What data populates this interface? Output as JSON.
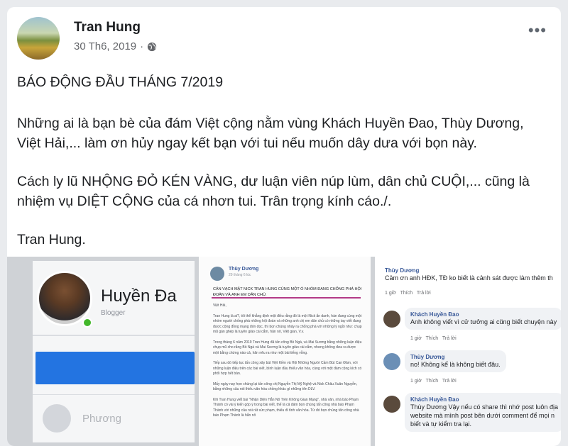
{
  "post": {
    "author": "Tran Hung",
    "date": "30 Th6, 2019",
    "separator": "·",
    "more_label": "•••",
    "title": "BÁO ĐỘNG ĐẦU THÁNG 7/2019",
    "paragraph1": "Những ai là bạn bè của đám Việt cộng nằm vùng Khách Huyền Đao, Thùy Dương, Việt Hải,... làm ơn hủy ngay kết bạn với tui nếu muốn dây dưa với bọn này.",
    "paragraph2": "Cách ly lũ NHỘNG ĐỎ KÉN VÀNG, dư luận viên núp lùm, dân chủ CUỘI,... cũng là nhiệm vụ DIỆT CỘNG của cá nhơn tui. Trân trọng kính cáo./.",
    "signature": "Tran Hung."
  },
  "screenshot_profile": {
    "name": "Huyền Đa",
    "subtitle": "Blogger",
    "partial_label": "Phương"
  },
  "screenshot_post": {
    "author": "Thùy Dương",
    "date": "29 tháng 6 lúc",
    "headline": "CẢN VẠCH MẶT NICK TRAN HUNG CÙNG MỘT Ổ NHÓM ĐANG CHỐNG PHÁ HỘI ĐOÀN VÀ ANH EM DÂN CHỦ.",
    "greeting": "Việt Hải,",
    "paragraphs": [
      "Tran Hung là ai?, tôi thể khẳng định một điều rằng đó là một Nick ẩn danh, hàn đang cùng một nhóm người chống phá những hội đoàn và những anh chị em dân chủ có những tay viết đang được cộng đồng mạng đón đọc, thì bọn chúng nhảy ra chống phá với những lý ngồi như: chụp mũ gán ghép là tuyên giáo cài cắm, hăn nô, Việt gian, V.v.",
      "Trong tháng 6 năm 2019 Tran Hung đã tấn công Bồ Ngà, và Mai Sương bằng những luận điệu chụp mũ cho rằng Bồ Ngà và Mai Sương là tuyên giáo cài cắm, nhưng không đưa ra được một bằng chứng nào cả, hăn nêu ra như một bài tiếng vỗng.",
      "Tiếp sau đó tiếp tục tấn công xây bút Việt Kiền và Hội Những Người Cầm Bút Can Đảm, với những luận điệu trên các bài viết, bình luận đầu thiếu văn hóa, cùng với một đám cộng kích có phối hợp hết bản.",
      "Mấy ngày nay họn chúng lại tấn công chị Nguyễn Thị Mỹ Nghệ và Nick Châu Xuân Nguyễn, bằng những câu nói thiếu văn hóa chồng khác gì những tên DLV.",
      "Khi Tran Hung viết bài \"Nhận Diện Hẳn Nô Trên Không Gian Mạng\", nhà văn, nhà báo Phạm Thành có vài ý kiến góp ý trong bài viết, thế là cả đám bọn chúng tấn công nhà báo Phạm Thành với những câu nói rất sức phạm, thiếu đi tính văn hóa. Từ đó bọn chúng tấn công nhà báo Phạm Thành là hẳn nô"
    ]
  },
  "screenshot_comments": [
    {
      "author": "Thùy Dương",
      "text": "Cảm ơn anh HĐK, TĐ ko biết là cảnh sát được làm thêm th",
      "time": "1 giờ",
      "like": "Thích",
      "reply": "Trả lời"
    },
    {
      "author": "Khách Huyền Đao",
      "text": "Anh không viết vì cử tưởng ai cũng biết chuyện này",
      "time": "1 giờ",
      "like": "Thích",
      "reply": "Trả lời"
    },
    {
      "author": "Thùy Dương",
      "text": "no! Không kể là không biết đâu.",
      "time": "1 giờ",
      "like": "Thích",
      "reply": "Trả lời"
    },
    {
      "author": "Khách Huyền Đao",
      "text": "Thùy Dương Vậy nếu có share thì nhớ post luôn địa",
      "text2": "website mà mình post bên dưới comment để mọi n",
      "text3": "biết và tự kiểm tra lại.",
      "time": "1 giờ",
      "like": "Thích",
      "reply": "Trả lời"
    }
  ],
  "colors": {
    "link": "#385898",
    "secondary_text": "#65676b",
    "blue_bar": "#2374e1",
    "online": "#42b72a",
    "headline_rule": "#b23a87"
  },
  "icons": [
    "globe-icon",
    "more-icon",
    "online-status-icon"
  ]
}
